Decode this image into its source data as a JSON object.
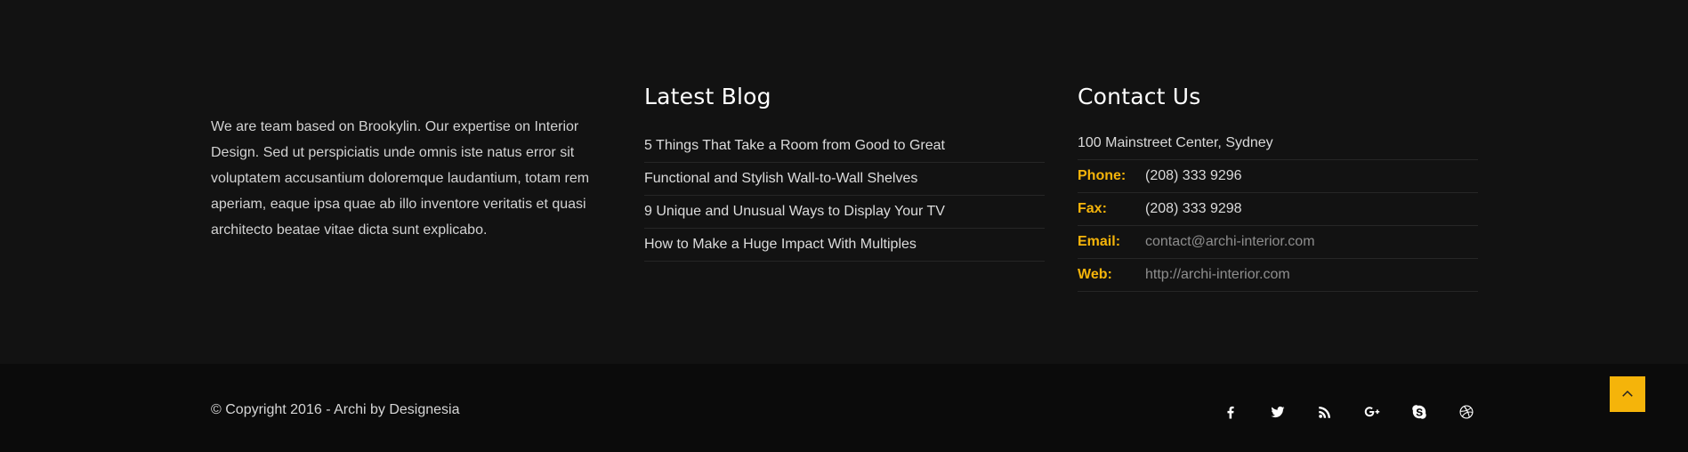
{
  "about": {
    "text": "We are team based on Brookylin. Our expertise on Interior Design. Sed ut perspiciatis unde omnis iste natus error sit voluptatem accusantium doloremque laudantium, totam rem aperiam, eaque ipsa quae ab illo inventore veritatis et quasi architecto beatae vitae dicta sunt explicabo."
  },
  "blog": {
    "title": "Latest Blog",
    "posts": [
      "5 Things That Take a Room from Good to Great",
      "Functional and Stylish Wall-to-Wall Shelves",
      "9 Unique and Unusual Ways to Display Your TV",
      "How to Make a Huge Impact With Multiples"
    ]
  },
  "contact": {
    "title": "Contact Us",
    "address": "100 Mainstreet Center, Sydney",
    "phone_label": "Phone:",
    "phone": "(208) 333 9296",
    "fax_label": "Fax:",
    "fax": "(208) 333 9298",
    "email_label": "Email:",
    "email": "contact@archi-interior.com",
    "web_label": "Web:",
    "web": "http://archi-interior.com"
  },
  "footer": {
    "copyright": "© Copyright 2016 - Archi by Designesia",
    "social": [
      "facebook-icon",
      "twitter-icon",
      "rss-icon",
      "google-plus-icon",
      "skype-icon",
      "dribbble-icon"
    ]
  },
  "colors": {
    "background": "#121212",
    "bottom_bar": "#0b0b0b",
    "accent": "#f5b40a"
  }
}
